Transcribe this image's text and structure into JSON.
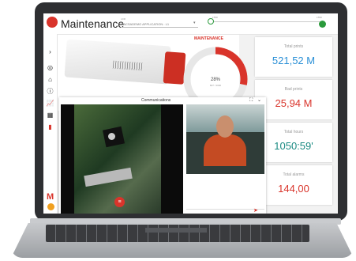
{
  "app": {
    "title": "Maintenance"
  },
  "header": {
    "application_caption": "LDR",
    "application_value": "MACSADEMO APPLICATION : L1",
    "slider_min_label": "LT00",
    "slider_max_label": "LT00"
  },
  "sidebar": {
    "items": [
      "chevron-right-icon",
      "location-icon",
      "home-icon",
      "info-icon",
      "chart-icon",
      "calendar-icon",
      "alert-icon"
    ],
    "brand_letter": "M"
  },
  "maintenance": {
    "label": "MAINTENANCE",
    "gauge_percent": "28%",
    "gauge_sub": "827 / 3000",
    "gauge_fraction": 0.28
  },
  "stats": [
    {
      "caption": "Total prints",
      "value": "521,52 M",
      "color": "#2a8fd6"
    },
    {
      "caption": "Bad prints",
      "value": "25,94 M",
      "color": "#d9342b"
    },
    {
      "caption": "Total hours",
      "value": "1050:59'",
      "color": "#1a8a82"
    },
    {
      "caption": "Total alarms",
      "value": "144,00",
      "color": "#d9342b"
    }
  ],
  "communications": {
    "title": "Communications",
    "expand_icon": "expand-icon",
    "close_icon": "chevron-down-icon",
    "video_button_icon": "menu-icon",
    "send_icon": "send-icon"
  },
  "colors": {
    "accent": "#d9342b",
    "success": "#2b9a3c"
  }
}
